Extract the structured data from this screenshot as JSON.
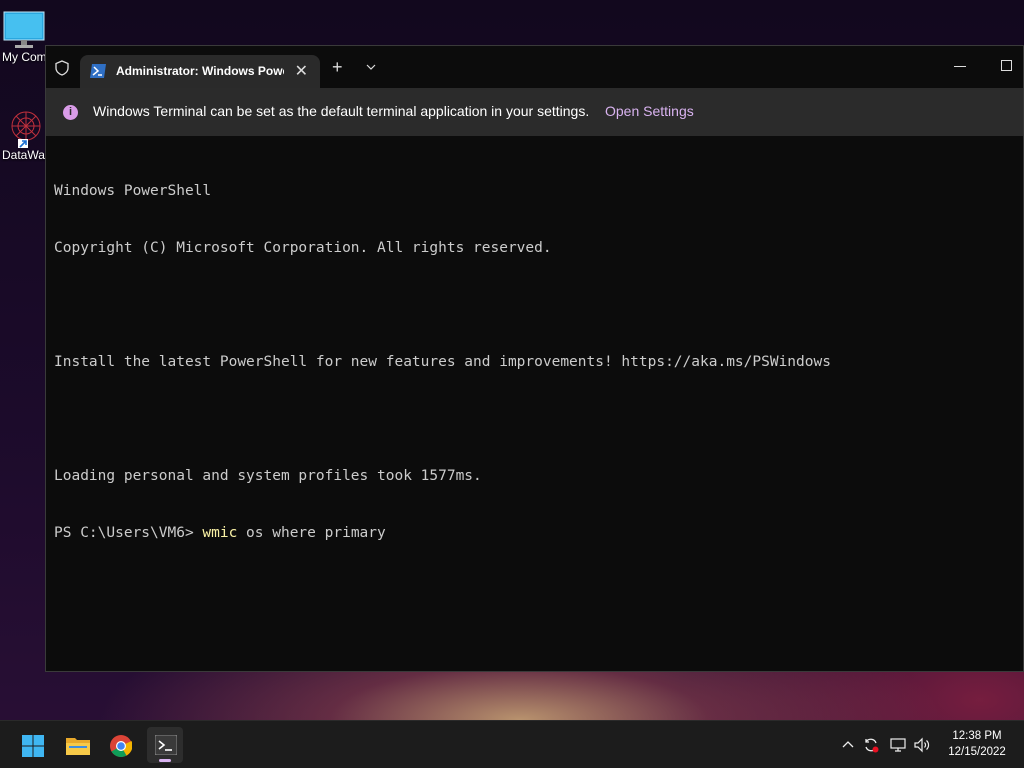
{
  "desktop": {
    "icons": [
      {
        "label": "My Computer",
        "icon": "monitor-icon"
      },
      {
        "label": "DataWarrior",
        "icon": "datawarrior-icon"
      }
    ]
  },
  "terminal": {
    "tab_title": "Administrator: Windows PowerShell",
    "tab_icon": "powershell-icon",
    "infobar": {
      "message": "Windows Terminal can be set as the default terminal application in your settings.",
      "link": "Open Settings"
    },
    "lines": [
      "Windows PowerShell",
      "Copyright (C) Microsoft Corporation. All rights reserved.",
      "",
      "Install the latest PowerShell for new features and improvements! https://aka.ms/PSWindows",
      "",
      "Loading personal and system profiles took 1577ms."
    ],
    "prompt": "PS C:\\Users\\VM6> ",
    "command": "wmic",
    "command_args": " os where primary"
  },
  "taskbar": {
    "apps": [
      "start-icon",
      "file-explorer-icon",
      "chrome-icon",
      "terminal-icon"
    ],
    "tray": [
      "chevron-up-icon",
      "sync-icon",
      "network-icon",
      "volume-icon"
    ],
    "clock": {
      "time": "12:38 PM",
      "date": "12/15/2022"
    }
  },
  "colors": {
    "accent": "#d9b3f0",
    "command": "#f9f1a5",
    "console_bg": "#0c0c0c"
  }
}
